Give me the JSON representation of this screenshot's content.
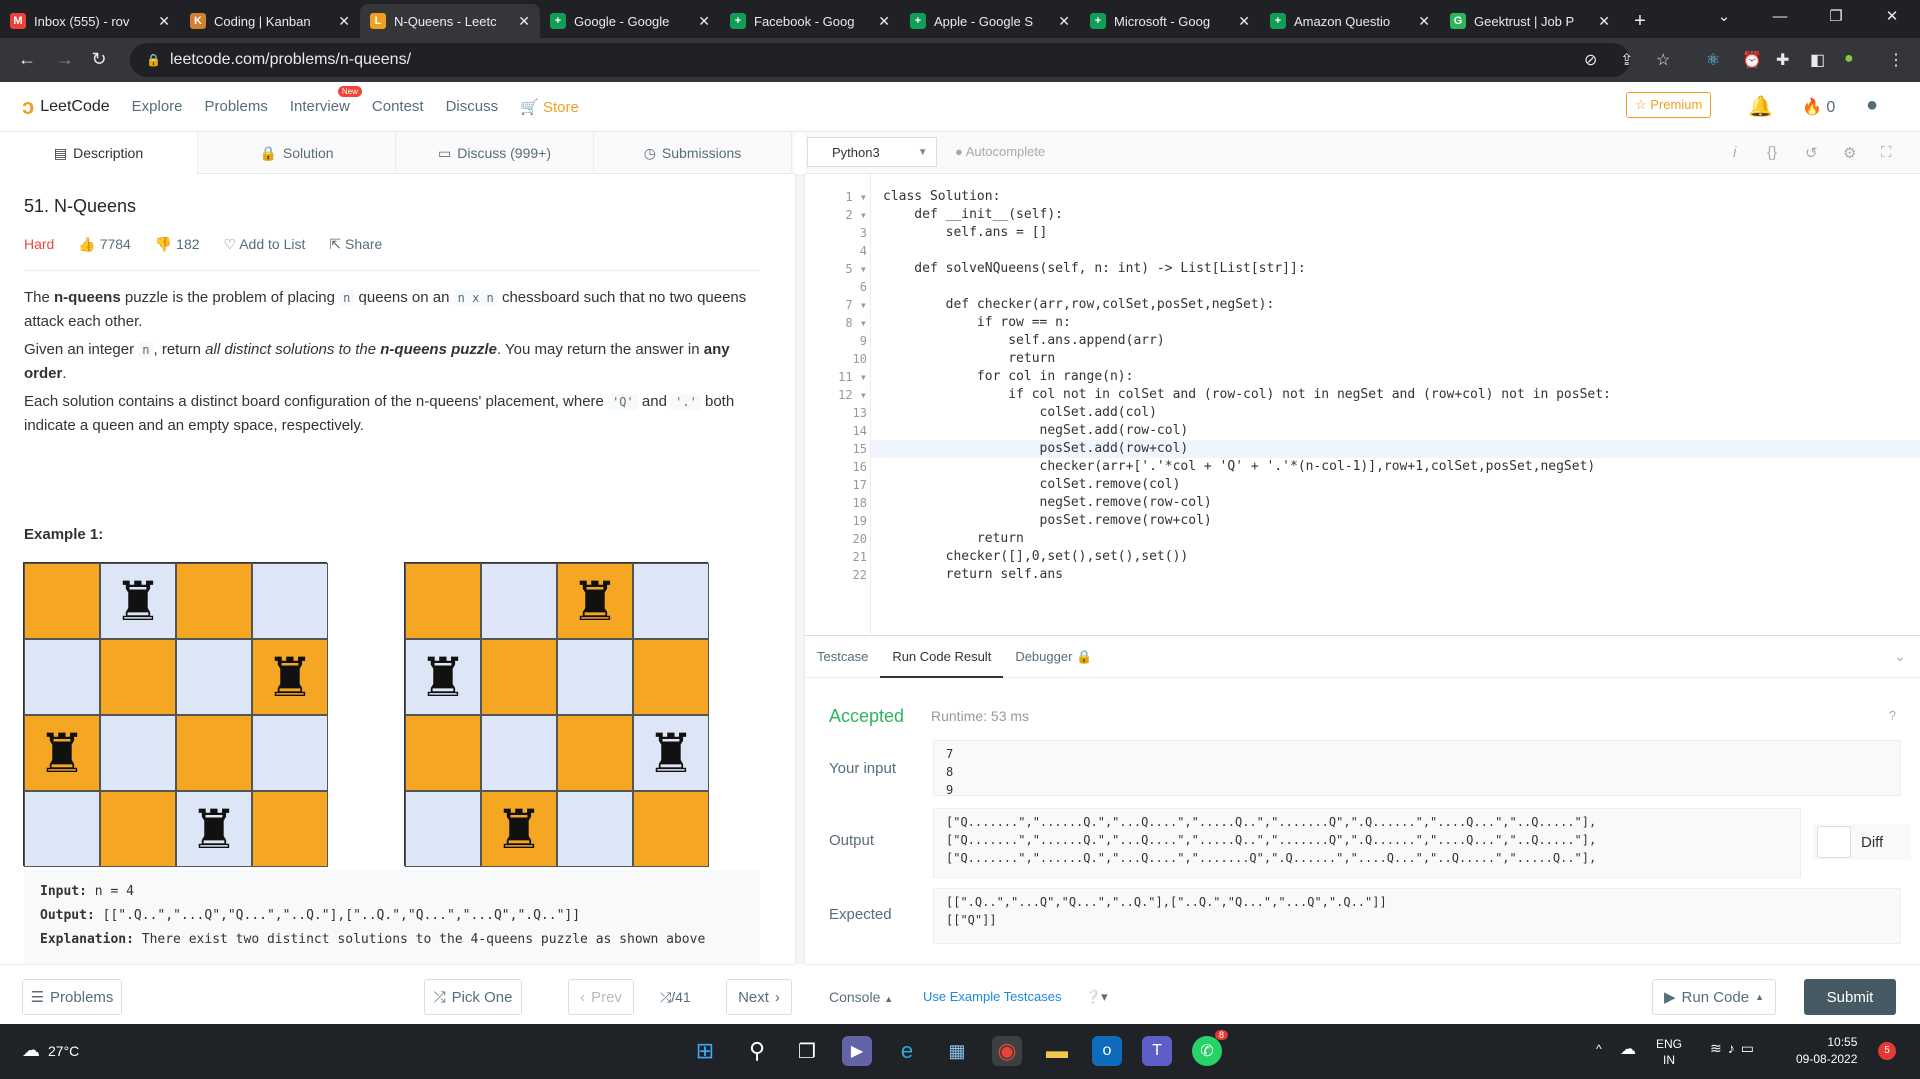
{
  "browser": {
    "tabs": [
      {
        "title": "Inbox (555) - rov",
        "icon": "gmail-icon",
        "color": "#ea4335",
        "glyph": "M"
      },
      {
        "title": "Coding | Kanban",
        "icon": "kanban-icon",
        "color": "#d08030",
        "glyph": "K"
      },
      {
        "title": "N-Queens - Leetc",
        "icon": "leetcode-icon",
        "color": "#f0a020",
        "glyph": "L",
        "active": true
      },
      {
        "title": "Google - Google",
        "icon": "sheets-icon",
        "color": "#0f9d58",
        "glyph": "+"
      },
      {
        "title": "Facebook - Goog",
        "icon": "sheets-icon",
        "color": "#0f9d58",
        "glyph": "+"
      },
      {
        "title": "Apple - Google S",
        "icon": "sheets-icon",
        "color": "#0f9d58",
        "glyph": "+"
      },
      {
        "title": "Microsoft - Goog",
        "icon": "sheets-icon",
        "color": "#0f9d58",
        "glyph": "+"
      },
      {
        "title": "Amazon Questio",
        "icon": "sheets-icon",
        "color": "#0f9d58",
        "glyph": "+"
      },
      {
        "title": "Geektrust | Job P",
        "icon": "geektrust-icon",
        "color": "#2db55d",
        "glyph": "G"
      }
    ],
    "url": "leetcode.com/problems/n-queens/"
  },
  "header": {
    "logo": "LeetCode",
    "nav": [
      "Explore",
      "Problems",
      "Interview",
      "Contest",
      "Discuss",
      "Store"
    ],
    "new_badge": "New",
    "premium": "Premium",
    "points": "0"
  },
  "left_tabs": [
    "Description",
    "Solution",
    "Discuss (999+)",
    "Submissions"
  ],
  "problem": {
    "title": "51. N-Queens",
    "difficulty": "Hard",
    "likes": "7784",
    "dislikes": "182",
    "add_to_list": "Add to List",
    "share": "Share",
    "example_heading": "Example 1:",
    "example_input": "n = 4",
    "example_output": "[[\".Q..\",\"...Q\",\"Q...\",\"..Q.\"],[\"..Q.\",\"Q...\",\"...Q\",\".Q..\"]]",
    "example_explanation": "There exist two distinct solutions to the 4-queens puzzle as shown above",
    "labels": {
      "input": "Input:",
      "output": "Output:",
      "explanation": "Explanation:"
    },
    "board1": [
      ".Q..",
      "...Q",
      "Q...",
      "..Q."
    ],
    "board2": [
      "..Q.",
      "Q...",
      "...Q",
      ".Q.."
    ]
  },
  "left_footer": {
    "problems": "Problems",
    "pick_one": "Pick One",
    "prev": "Prev",
    "page": "/41",
    "next": "Next"
  },
  "editor": {
    "language": "Python3",
    "autocomplete": "Autocomplete",
    "lines": [
      "class Solution:",
      "    def __init__(self):",
      "        self.ans = []",
      "",
      "    def solveNQueens(self, n: int) -> List[List[str]]:",
      "",
      "        def checker(arr,row,colSet,posSet,negSet):",
      "            if row == n:",
      "                self.ans.append(arr)",
      "                return",
      "            for col in range(n):",
      "                if col not in colSet and (row-col) not in negSet and (row+col) not in posSet:",
      "                    colSet.add(col)",
      "                    negSet.add(row-col)",
      "                    posSet.add(row+col)",
      "                    checker(arr+['.'*col + 'Q' + '.'*(n-col-1)],row+1,colSet,posSet,negSet)",
      "                    colSet.remove(col)",
      "                    negSet.remove(row-col)",
      "                    posSet.remove(row+col)",
      "            return",
      "        checker([],0,set(),set(),set())",
      "        return self.ans"
    ]
  },
  "bottom_tabs": [
    "Testcase",
    "Run Code Result",
    "Debugger"
  ],
  "result": {
    "status": "Accepted",
    "runtime": "Runtime: 53 ms",
    "your_input_label": "Your input",
    "your_input": "7\n8\n9",
    "output_label": "Output",
    "output": "[\"Q.......\",\"......Q.\",\"...Q....\",\".....Q..\",\".......Q\",\".Q......\",\"....Q...\",\"..Q.....\"],\n[\"Q.......\",\"......Q.\",\"...Q....\",\".....Q..\",\".......Q\",\".Q......\",\"....Q...\",\"..Q.....\"],\n[\"Q.......\",\"......Q.\",\"...Q....\",\".......Q\",\".Q......\",\"....Q...\",\"..Q.....\",\".....Q..\"],",
    "diff": "Diff",
    "expected_label": "Expected",
    "expected": "[[\".Q..\",\"...Q\",\"Q...\",\"..Q.\"],[\"..Q.\",\"Q...\",\"...Q\",\".Q..\"]]\n[[\"Q\"]]"
  },
  "right_footer": {
    "console": "Console",
    "use_example": "Use Example Testcases",
    "run_code": "Run Code",
    "submit": "Submit"
  },
  "taskbar": {
    "weather": "27°C",
    "lang1": "ENG",
    "lang2": "IN",
    "time": "10:55",
    "date": "09-08-2022",
    "notif": "5",
    "whatsapp_badge": "8"
  }
}
